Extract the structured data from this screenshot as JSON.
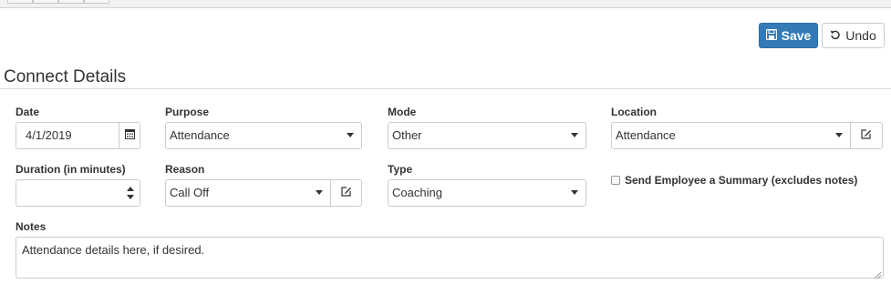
{
  "toolbar": {
    "save_label": "Save",
    "undo_label": "Undo"
  },
  "section": {
    "title": "Connect Details"
  },
  "form": {
    "date": {
      "label": "Date",
      "value": "4/1/2019"
    },
    "purpose": {
      "label": "Purpose",
      "value": "Attendance"
    },
    "mode": {
      "label": "Mode",
      "value": "Other"
    },
    "location": {
      "label": "Location",
      "value": "Attendance"
    },
    "duration": {
      "label": "Duration (in minutes)",
      "value": ""
    },
    "reason": {
      "label": "Reason",
      "value": "Call Off"
    },
    "type": {
      "label": "Type",
      "value": "Coaching"
    },
    "send_summary": {
      "label": "Send Employee a Summary (excludes notes)",
      "checked": false
    },
    "notes": {
      "label": "Notes",
      "value": "Attendance details here, if desired."
    }
  },
  "icons": {
    "save": "floppy-disk-icon",
    "undo": "undo-icon",
    "calendar": "calendar-icon",
    "edit": "edit-icon",
    "stepper": "spinner-arrows-icon",
    "dropdown": "caret-down-icon"
  },
  "colors": {
    "primary": "#337ab7",
    "border": "#cccccc",
    "text": "#333333"
  }
}
